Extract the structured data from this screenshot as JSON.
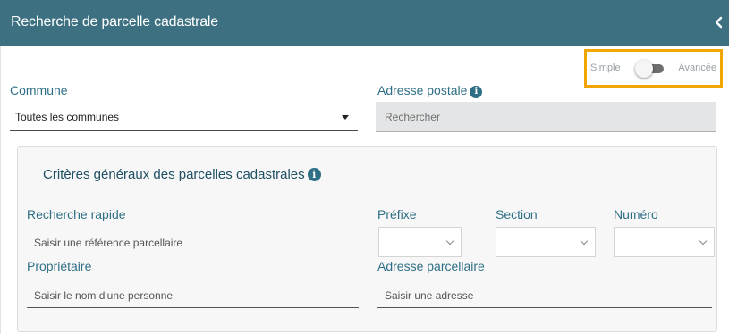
{
  "header": {
    "title": "Recherche de parcelle cadastrale",
    "collapse_icon": "chevron-left-icon"
  },
  "mode_toggle": {
    "left_label": "Simple",
    "right_label": "Avancée",
    "selected": "Simple"
  },
  "commune": {
    "label": "Commune",
    "value": "Toutes les communes"
  },
  "adresse_postale": {
    "label": "Adresse postale",
    "info_glyph": "i",
    "placeholder": "Rechercher"
  },
  "panel": {
    "title": "Critères généraux des parcelles cadastrales",
    "info_glyph": "i",
    "recherche_rapide": {
      "label": "Recherche rapide",
      "placeholder": "Saisir une référence parcellaire"
    },
    "prefixe": {
      "label": "Préfixe"
    },
    "section": {
      "label": "Section"
    },
    "numero": {
      "label": "Numéro"
    },
    "proprietaire": {
      "label": "Propriétaire",
      "placeholder": "Saisir le nom d'une personne"
    },
    "adresse_parcellaire": {
      "label": "Adresse parcellaire",
      "placeholder": "Saisir une adresse"
    }
  },
  "colors": {
    "header_bg": "#3d7081",
    "label": "#2f6f86",
    "highlight": "#f0a500"
  }
}
